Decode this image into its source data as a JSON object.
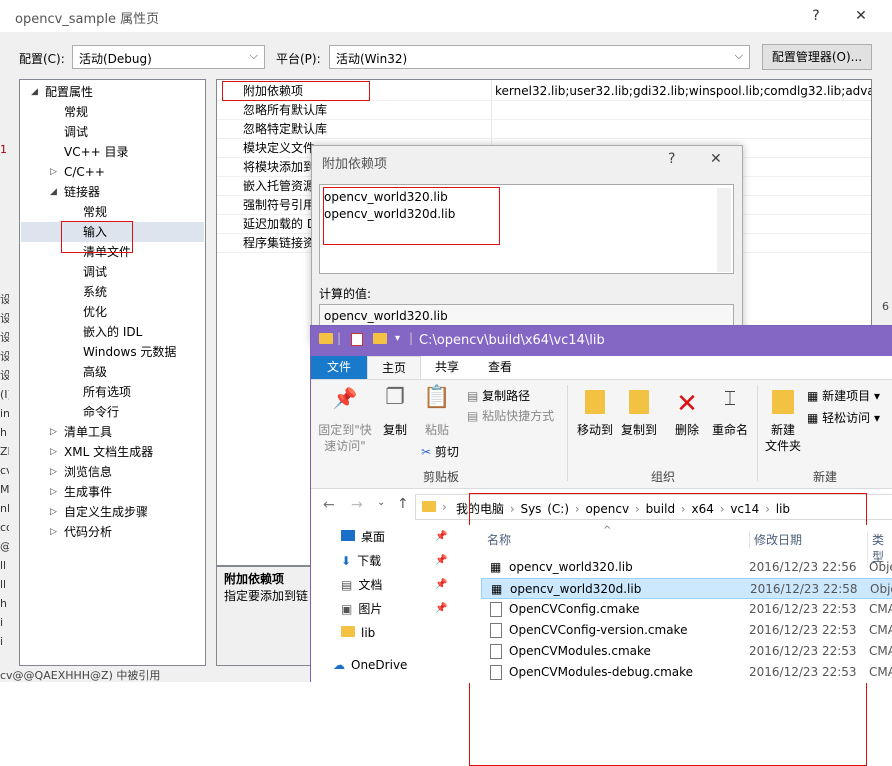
{
  "window": {
    "title": "opencv_sample 属性页",
    "help": "?",
    "close": "✕"
  },
  "config": {
    "label": "配置(C):",
    "value": "活动(Debug)",
    "platform_label": "平台(P):",
    "platform_value": "活动(Win32)",
    "manager_button": "配置管理器(O)..."
  },
  "tree": [
    {
      "label": "配置属性",
      "toggle": "◢",
      "indent": 0
    },
    {
      "label": "常规",
      "indent": 1
    },
    {
      "label": "调试",
      "indent": 1
    },
    {
      "label": "VC++ 目录",
      "indent": 1
    },
    {
      "label": "C/C++",
      "toggle": "▷",
      "indent": 1
    },
    {
      "label": "链接器",
      "toggle": "◢",
      "indent": 1
    },
    {
      "label": "常规",
      "indent": 2
    },
    {
      "label": "输入",
      "indent": 2,
      "selected": true
    },
    {
      "label": "清单文件",
      "indent": 2
    },
    {
      "label": "调试",
      "indent": 2
    },
    {
      "label": "系统",
      "indent": 2
    },
    {
      "label": "优化",
      "indent": 2
    },
    {
      "label": "嵌入的 IDL",
      "indent": 2
    },
    {
      "label": "Windows 元数据",
      "indent": 2
    },
    {
      "label": "高级",
      "indent": 2
    },
    {
      "label": "所有选项",
      "indent": 2
    },
    {
      "label": "命令行",
      "indent": 2
    },
    {
      "label": "清单工具",
      "toggle": "▷",
      "indent": 1
    },
    {
      "label": "XML 文档生成器",
      "toggle": "▷",
      "indent": 1
    },
    {
      "label": "浏览信息",
      "toggle": "▷",
      "indent": 1
    },
    {
      "label": "生成事件",
      "toggle": "▷",
      "indent": 1
    },
    {
      "label": "自定义生成步骤",
      "toggle": "▷",
      "indent": 1
    },
    {
      "label": "代码分析",
      "toggle": "▷",
      "indent": 1
    }
  ],
  "props": [
    {
      "key": "附加依赖项",
      "value": "kernel32.lib;user32.lib;gdi32.lib;winspool.lib;comdlg32.lib;advapi3"
    },
    {
      "key": "忽略所有默认库",
      "value": ""
    },
    {
      "key": "忽略特定默认库",
      "value": ""
    },
    {
      "key": "模块定义文件",
      "value": ""
    },
    {
      "key": "将模块添加到",
      "value": ""
    },
    {
      "key": "嵌入托管资源",
      "value": ""
    },
    {
      "key": "强制符号引用",
      "value": ""
    },
    {
      "key": "延迟加载的 D",
      "value": ""
    },
    {
      "key": "程序集链接资",
      "value": ""
    }
  ],
  "description": {
    "title": "附加依赖项",
    "text": "指定要添加到链"
  },
  "dialog": {
    "title": "附加依赖项",
    "help": "?",
    "close": "✕",
    "entries": [
      "opencv_world320.lib",
      "opencv_world320d.lib"
    ],
    "computed_label": "计算的值:",
    "computed_value": "opencv_world320.lib"
  },
  "explorer": {
    "path": "C:\\opencv\\build\\x64\\vc14\\lib",
    "tabs": [
      "文件",
      "主页",
      "共享",
      "查看"
    ],
    "ribbon": {
      "pin": "固定到\"快\n速访问\"",
      "copy": "复制",
      "paste": "粘贴",
      "copy_path": "复制路径",
      "paste_shortcut": "粘贴快捷方式",
      "cut": "剪切",
      "clipboard": "剪贴板",
      "move_to": "移动到",
      "copy_to": "复制到",
      "delete": "删除",
      "rename": "重命名",
      "organize": "组织",
      "new_folder": "新建\n文件夹",
      "new_item": "新建项目",
      "easy_access": "轻松访问",
      "new": "新建"
    },
    "breadcrumb": [
      "我的电脑",
      "Sys (C:)",
      "opencv",
      "build",
      "x64",
      "vc14",
      "lib"
    ],
    "nav": [
      {
        "label": "桌面",
        "icon": "desktop-icon"
      },
      {
        "label": "下载",
        "icon": "download-icon"
      },
      {
        "label": "文档",
        "icon": "document-icon"
      },
      {
        "label": "图片",
        "icon": "picture-icon"
      },
      {
        "label": "lib",
        "icon": "folder-icon"
      },
      {
        "label": "OneDrive",
        "icon": "cloud-icon"
      }
    ],
    "columns": {
      "name": "名称",
      "date": "修改日期",
      "type": "类型"
    },
    "files": [
      {
        "name": "opencv_world320.lib",
        "date": "2016/12/23 22:56",
        "type": "Obje",
        "icon": "lib-icon"
      },
      {
        "name": "opencv_world320d.lib",
        "date": "2016/12/23 22:58",
        "type": "Obje",
        "icon": "lib-icon",
        "selected": true
      },
      {
        "name": "OpenCVConfig.cmake",
        "date": "2016/12/23 22:53",
        "type": "CMA",
        "icon": "file-icon"
      },
      {
        "name": "OpenCVConfig-version.cmake",
        "date": "2016/12/23 22:53",
        "type": "CMA",
        "icon": "file-icon"
      },
      {
        "name": "OpenCVModules.cmake",
        "date": "2016/12/23 22:53",
        "type": "CMA",
        "icon": "file-icon"
      },
      {
        "name": "OpenCVModules-debug.cmake",
        "date": "2016/12/23 22:53",
        "type": "CMA",
        "icon": "file-icon"
      }
    ]
  },
  "background": {
    "left_fragments": [
      "1",
      "设",
      "设",
      "设",
      "设",
      "设",
      "(I)",
      "in",
      "h",
      "ZI",
      "cv",
      "Me",
      "nl",
      "co",
      "@",
      "ll",
      "ll",
      "h",
      "i",
      "i"
    ],
    "bottom_fragment": "cv@@QAEXHHH@Z) 中被引用",
    "right_fragment": "6"
  },
  "colors": {
    "accent": "#0078d7",
    "explorer_bar": "#8466c5",
    "highlight_red": "#e01010",
    "selection": "#cce8ff"
  }
}
